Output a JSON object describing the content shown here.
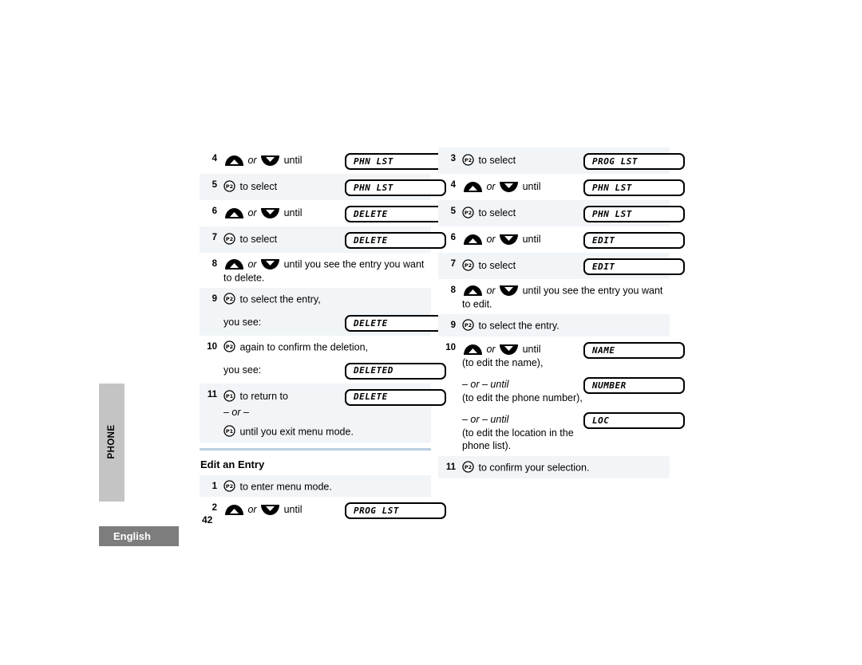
{
  "sidebar": {
    "tab_label": "PHONE",
    "language_label": "English"
  },
  "footer": {
    "page_number": "42"
  },
  "icons": {
    "up_button": "scroll-up-button-icon",
    "down_button": "scroll-down-button-icon",
    "p1_button": "p1-button-icon",
    "p2_button": "p2-button-icon"
  },
  "colors": {
    "side_tab": "#c4c4c4",
    "language_tab": "#7d7d7d",
    "row_shade": "#f1f5f8",
    "rule": "#b9cfe4"
  },
  "left_column": {
    "steps": [
      {
        "num": "4",
        "type": "updown",
        "text_or": "or",
        "text_after": "until",
        "lcd": "PHN LST"
      },
      {
        "num": "5",
        "type": "p2",
        "text_after": "to select",
        "lcd": "PHN LST"
      },
      {
        "num": "6",
        "type": "updown",
        "text_or": "or",
        "text_after": "until",
        "lcd": "DELETE"
      },
      {
        "num": "7",
        "type": "p2",
        "text_after": "to select",
        "lcd": "DELETE"
      },
      {
        "num": "8",
        "type": "updown",
        "text_or": "or",
        "text_after": "until you see the entry you want to delete."
      },
      {
        "num": "9",
        "type": "p2",
        "text_after": "to select the entry,",
        "yousee_label": "you see:",
        "lcd": "DELETE"
      },
      {
        "num": "10",
        "type": "p2",
        "text_after": "again to confirm the deletion,",
        "yousee_label": "you see:",
        "lcd": "DELETED"
      },
      {
        "num": "11",
        "type": "p1",
        "text_after": "to return to",
        "lcd": "DELETE",
        "or_label": "– or –",
        "alt_text": "until you exit menu mode."
      }
    ],
    "section_title": "Edit an Entry",
    "edit_steps": [
      {
        "num": "1",
        "type": "p2",
        "text_after": "to enter menu mode."
      },
      {
        "num": "2",
        "type": "updown",
        "text_or": "or",
        "text_after": "until",
        "lcd": "PROG LST"
      }
    ]
  },
  "right_column": {
    "steps": [
      {
        "num": "3",
        "type": "p2",
        "text_after": "to select",
        "lcd": "PROG LST"
      },
      {
        "num": "4",
        "type": "updown",
        "text_or": "or",
        "text_after": "until",
        "lcd": "PHN LST"
      },
      {
        "num": "5",
        "type": "p2",
        "text_after": "to select",
        "lcd": "PHN LST"
      },
      {
        "num": "6",
        "type": "updown",
        "text_or": "or",
        "text_after": "until",
        "lcd": "EDIT"
      },
      {
        "num": "7",
        "type": "p2",
        "text_after": "to select",
        "lcd": "EDIT"
      },
      {
        "num": "8",
        "type": "updown",
        "text_or": "or",
        "text_after": "until you see the entry you want to edit."
      },
      {
        "num": "9",
        "type": "p2",
        "text_after": "to select the entry."
      },
      {
        "num": "10",
        "type": "updown",
        "text_or": "or",
        "text_after": "until",
        "note": "(to edit the name),",
        "lcd": "NAME",
        "alt1_or": "– or – until",
        "alt1_note": "(to edit the phone number),",
        "alt1_lcd": "NUMBER",
        "alt2_or": "– or – until",
        "alt2_note": "(to edit the location in the phone list).",
        "alt2_lcd": "LOC"
      },
      {
        "num": "11",
        "type": "p2",
        "text_after": "to confirm your selection."
      }
    ]
  }
}
